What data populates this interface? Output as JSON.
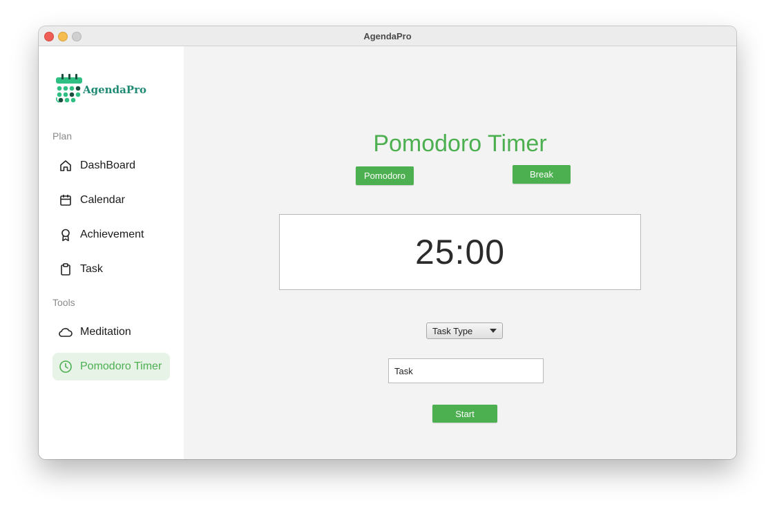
{
  "window": {
    "title": "AgendaPro"
  },
  "sidebar": {
    "logo_text": "AgendaPro",
    "sections": [
      {
        "label": "Plan",
        "items": [
          {
            "label": "DashBoard",
            "icon": "home-icon"
          },
          {
            "label": "Calendar",
            "icon": "calendar-icon"
          },
          {
            "label": "Achievement",
            "icon": "award-icon"
          },
          {
            "label": "Task",
            "icon": "clipboard-icon"
          }
        ]
      },
      {
        "label": "Tools",
        "items": [
          {
            "label": "Meditation",
            "icon": "cloud-icon"
          },
          {
            "label": "Pomodoro Timer",
            "icon": "clock-icon",
            "active": true
          }
        ]
      }
    ]
  },
  "main": {
    "title": "Pomodoro Timer",
    "mode_buttons": {
      "pomodoro": "Pomodoro",
      "break": "Break"
    },
    "timer": "25:00",
    "task_type": {
      "selected": "Task Type"
    },
    "task_input": {
      "placeholder": "Task",
      "value": ""
    },
    "start_label": "Start"
  },
  "colors": {
    "accent": "#4caf50",
    "active_bg": "#e6f3e6",
    "logo": "#1f8a73",
    "sidebar_bg": "#ffffff",
    "main_bg": "#f3f3f3"
  }
}
